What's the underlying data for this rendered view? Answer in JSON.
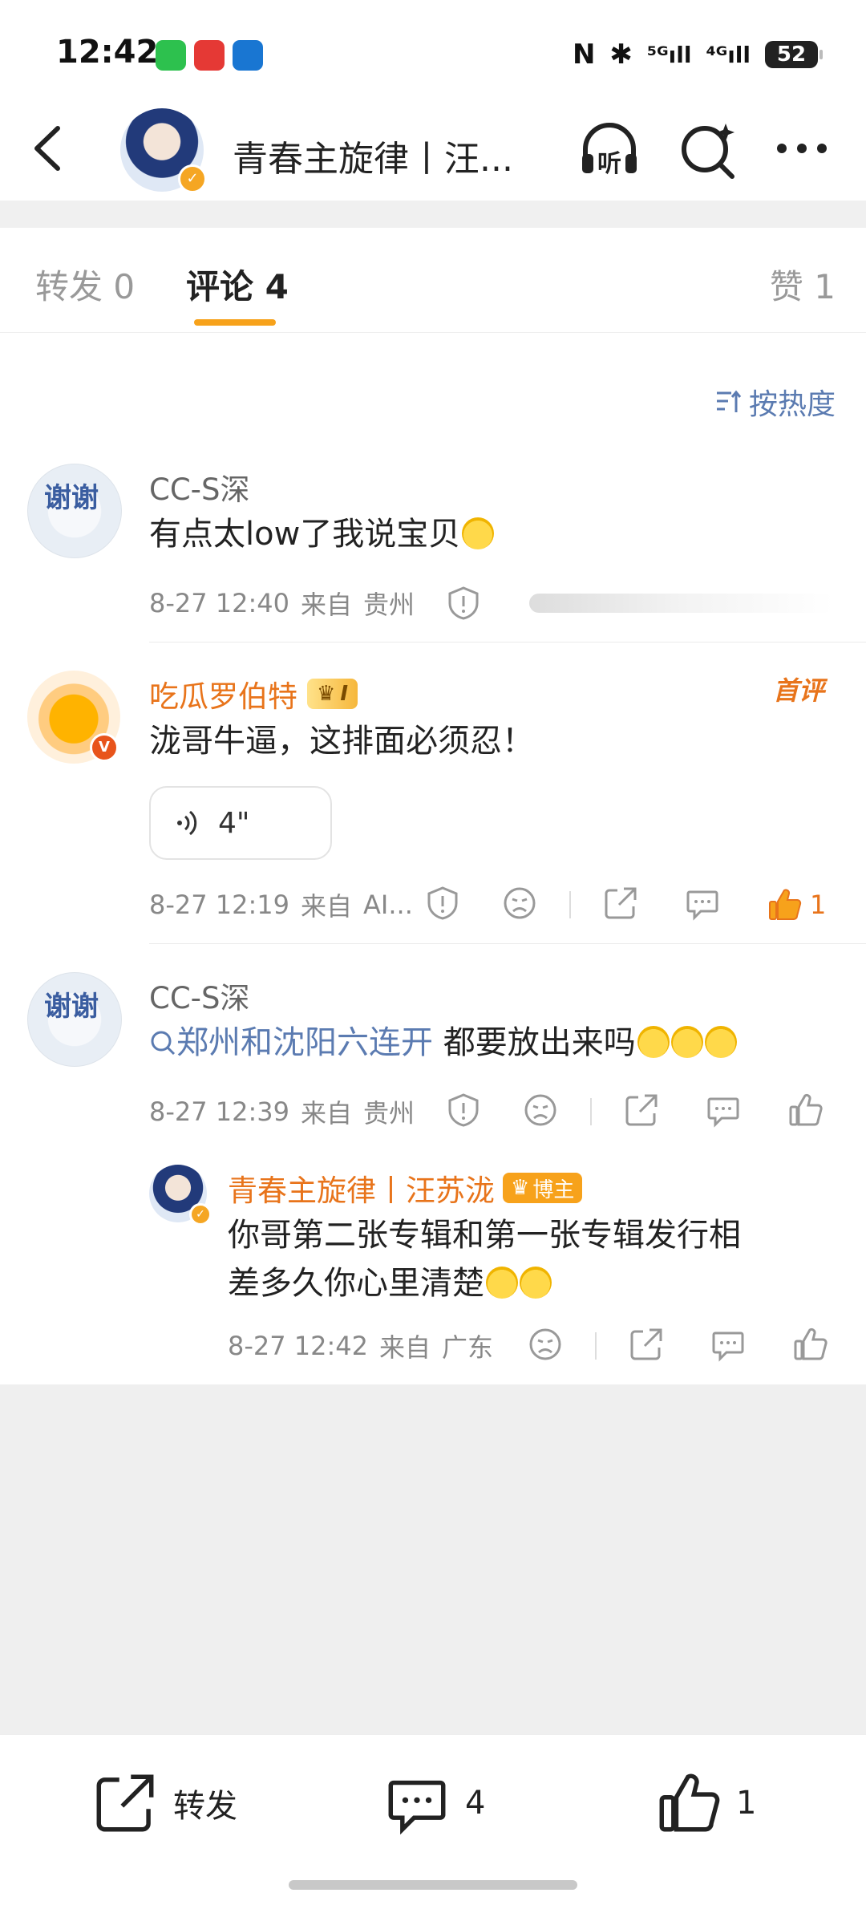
{
  "status": {
    "time": "12:42",
    "battery": "52",
    "nfc": "N",
    "bluetooth": "✱",
    "signal1": "⁵ᴳıll",
    "signal2": "⁴ᴳıll"
  },
  "header": {
    "title": "青春主旋律丨汪...",
    "listen_label": "听"
  },
  "tabs": {
    "repost": "转发 0",
    "comments": "评论 4",
    "likes": "赞 1"
  },
  "sort": {
    "label": "按热度"
  },
  "comments": [
    {
      "user": "CC-S深",
      "avatar_text": "谢谢",
      "text": "有点太low了我说宝贝",
      "time": "8-27 12:40",
      "from": "来自",
      "region": "贵州"
    },
    {
      "user": "吃瓜罗伯特",
      "level": "I",
      "text": "泷哥牛逼，这排面必须忍！",
      "voice": "4\"",
      "first_badge": "首评",
      "time": "8-27 12:19",
      "from": "来自",
      "region": "AI...",
      "like_count": "1"
    },
    {
      "user": "CC-S深",
      "avatar_text": "谢谢",
      "hashtag": "郑州和沈阳六连开",
      "text": " 都要放出来吗",
      "time": "8-27 12:39",
      "from": "来自",
      "region": "贵州"
    }
  ],
  "reply": {
    "user": "青春主旋律丨汪苏泷",
    "badge": "博主",
    "text_line1": "你哥第二张专辑和第一张专辑发行相",
    "text_line2": "差多久你心里清楚",
    "time": "8-27 12:42",
    "from": "来自",
    "region": "广东"
  },
  "bottom": {
    "repost": "转发",
    "comments": "4",
    "likes": "1"
  },
  "colors": {
    "accent": "#f7a21b",
    "link": "#5b7bb1",
    "orange": "#e8741b"
  }
}
